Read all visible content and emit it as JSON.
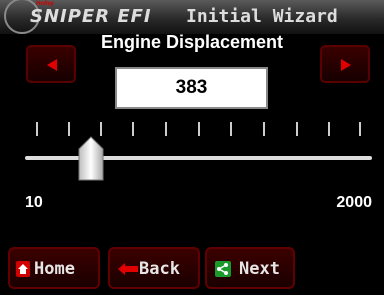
{
  "header": {
    "brand_tag": "Holley",
    "logo_text": "SNIPER EFI",
    "title": "Initial Wizard"
  },
  "wizard": {
    "subtitle": "Engine Displacement",
    "value": "383",
    "slider": {
      "min_label": "10",
      "max_label": "2000",
      "level_fraction": 0.19
    }
  },
  "icons": {
    "prev": "left-arrow-icon",
    "next": "right-arrow-icon",
    "home": "home-icon",
    "back": "back-arrow-icon",
    "next_nav": "share-next-icon"
  },
  "colors": {
    "accent": "#cc0000",
    "button_bg": "#2a0000",
    "background": "#000000"
  },
  "nav": {
    "home_label": "Home",
    "back_label": "Back",
    "next_label": "Next"
  }
}
